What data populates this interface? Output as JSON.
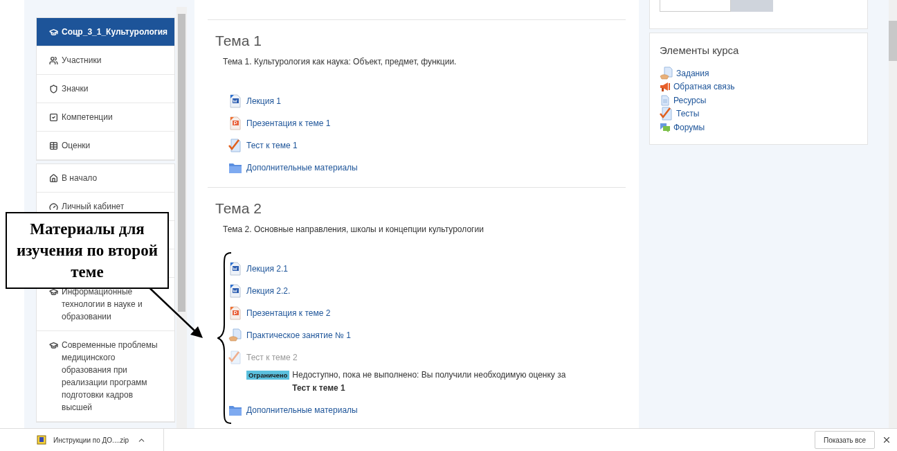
{
  "sidebar": {
    "groups": [
      {
        "items": [
          {
            "label": "Соцр_3_1_Культурология",
            "kind": "cap",
            "selected": true
          },
          {
            "label": "Участники",
            "kind": "users",
            "selected": false
          },
          {
            "label": "Значки",
            "kind": "shield",
            "selected": false
          },
          {
            "label": "Компетенции",
            "kind": "checkbox",
            "selected": false
          },
          {
            "label": "Оценки",
            "kind": "table",
            "selected": false
          }
        ]
      },
      {
        "items": [
          {
            "label": "В начало",
            "kind": "home",
            "selected": false
          },
          {
            "label": "Личный кабинет",
            "kind": "dashboard",
            "selected": false
          },
          {
            "kind": "covered"
          },
          {
            "kind": "covered"
          },
          {
            "label": "Информационные технологии в науке и образовании",
            "kind": "cap",
            "selected": false
          },
          {
            "label": "Современные проблемы медицинского образования при реализации программ подготовки кадров высшей",
            "kind": "cap",
            "selected": false
          }
        ]
      }
    ]
  },
  "sections": [
    {
      "title": "Тема 1",
      "summary": "Тема 1. Культурология как наука: Объект, предмет, функции.",
      "activities": [
        {
          "kind": "word",
          "label": "Лекция 1",
          "disabled": false
        },
        {
          "kind": "slides",
          "label": "Презентация к теме 1",
          "disabled": false
        },
        {
          "kind": "quiz",
          "label": "Тест к теме 1",
          "disabled": false
        },
        {
          "kind": "folder",
          "label": "Дополнительные материалы",
          "disabled": false
        }
      ]
    },
    {
      "title": "Тема 2",
      "summary": "Тема 2. Основные направления, школы и концепции культурологии",
      "activities": [
        {
          "kind": "word",
          "label": "Лекция 2.1",
          "disabled": false
        },
        {
          "kind": "word",
          "label": "Лекция 2.2.",
          "disabled": false
        },
        {
          "kind": "slides",
          "label": "Презентация к теме 2",
          "disabled": false
        },
        {
          "kind": "assign",
          "label": "Практическое занятие № 1",
          "disabled": false
        },
        {
          "kind": "quiz",
          "label": "Тест к теме 2",
          "disabled": true,
          "restriction": {
            "badge": "Ограничено",
            "text": "Недоступно, пока не выполнено: Вы получили необходимую оценку за **Тест к теме 1**"
          }
        },
        {
          "kind": "folder",
          "label": "Дополнительные материалы",
          "disabled": false
        }
      ]
    }
  ],
  "course_elements": {
    "title": "Элементы курса",
    "items": [
      {
        "kind": "assign",
        "label": "Задания"
      },
      {
        "kind": "feedback",
        "label": "Обратная связь"
      },
      {
        "kind": "resource",
        "label": "Ресурсы"
      },
      {
        "kind": "quiz",
        "label": "Тесты"
      },
      {
        "kind": "forum",
        "label": "Форумы"
      }
    ]
  },
  "callout": {
    "text": "Материалы для изучения по второй теме"
  },
  "downloads": [
    {
      "name": "Инструкции по ДО....zip"
    }
  ],
  "show_all": "Показать все"
}
